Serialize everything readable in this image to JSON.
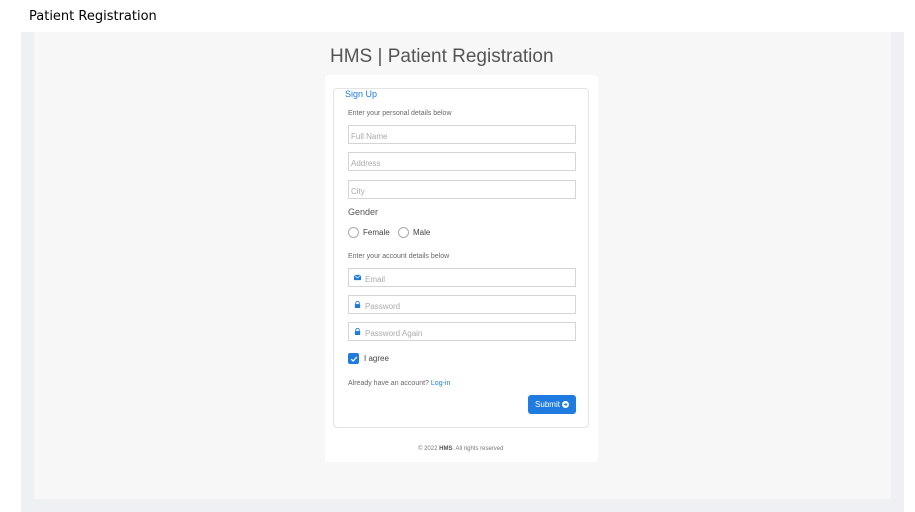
{
  "page": {
    "caption": "Patient Registration",
    "title": "HMS | Patient Registration"
  },
  "form": {
    "legend": "Sign Up",
    "personal_hint": "Enter your personal details below",
    "full_name_placeholder": "Full Name",
    "address_placeholder": "Address",
    "city_placeholder": "City",
    "gender_label": "Gender",
    "gender_options": {
      "female": "Female",
      "male": "Male"
    },
    "account_hint": "Enter your account details below",
    "email_placeholder": "Email",
    "password_placeholder": "Password",
    "password_again_placeholder": "Password Again",
    "agree_label": "I agree",
    "agree_checked": true,
    "already_text": "Already have an account?",
    "login_link": "Log-in",
    "submit_label": "Submit"
  },
  "footer": {
    "copyright": "© 2022",
    "brand": "HMS",
    "rights": ". All rights reserved"
  },
  "colors": {
    "accent": "#1f7be0"
  },
  "icons": {
    "email": "envelope-icon",
    "password": "lock-icon",
    "password_again": "lock-icon",
    "submit": "arrow-circle-right-icon",
    "agree": "checkmark-icon"
  }
}
